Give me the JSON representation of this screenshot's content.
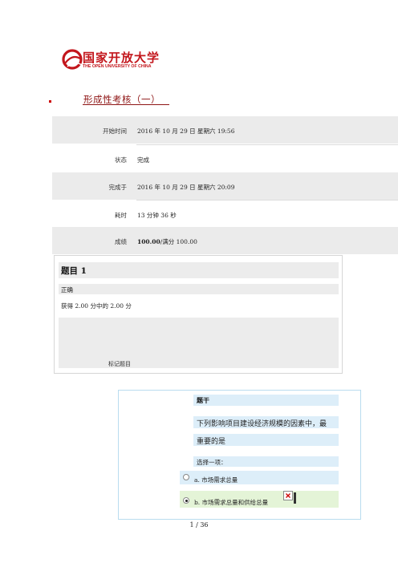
{
  "logo": {
    "name_cn": "国家开放大学",
    "name_en": "THE OPEN UNIVERSITY OF CHINA",
    "icon": "ouc-emblem-icon",
    "color": "#c3161c"
  },
  "doc_title": "形成性考核（一）",
  "summary": [
    {
      "label": "开始时间",
      "value": "2016 年 10 月 29 日  星期六  19:56"
    },
    {
      "label": "状态",
      "value": "完成"
    },
    {
      "label": "完成于",
      "value": "2016 年 10 月 29 日  星期六  20:09"
    },
    {
      "label": "耗时",
      "value": "13  分钟  36  秒"
    },
    {
      "label": "成绩",
      "value_bold": "100.00",
      "value_rest": "/满分 100.00"
    }
  ],
  "question": {
    "title": "题目 1",
    "status": "正确",
    "grade": "获得 2.00 分中的 2.00 分",
    "flag_label": "标记题目"
  },
  "content": {
    "stem_header": "题干",
    "question_line1": "下列影响项目建设经济规模的因素中，最",
    "question_line2": "重要的是",
    "choose_one": "选择一项：",
    "options": [
      {
        "text": "a. 市场需求总量",
        "selected": false
      },
      {
        "text": "b. 市场需求总量和供给总量",
        "selected": true
      }
    ]
  },
  "page_number": "1  /  36"
}
